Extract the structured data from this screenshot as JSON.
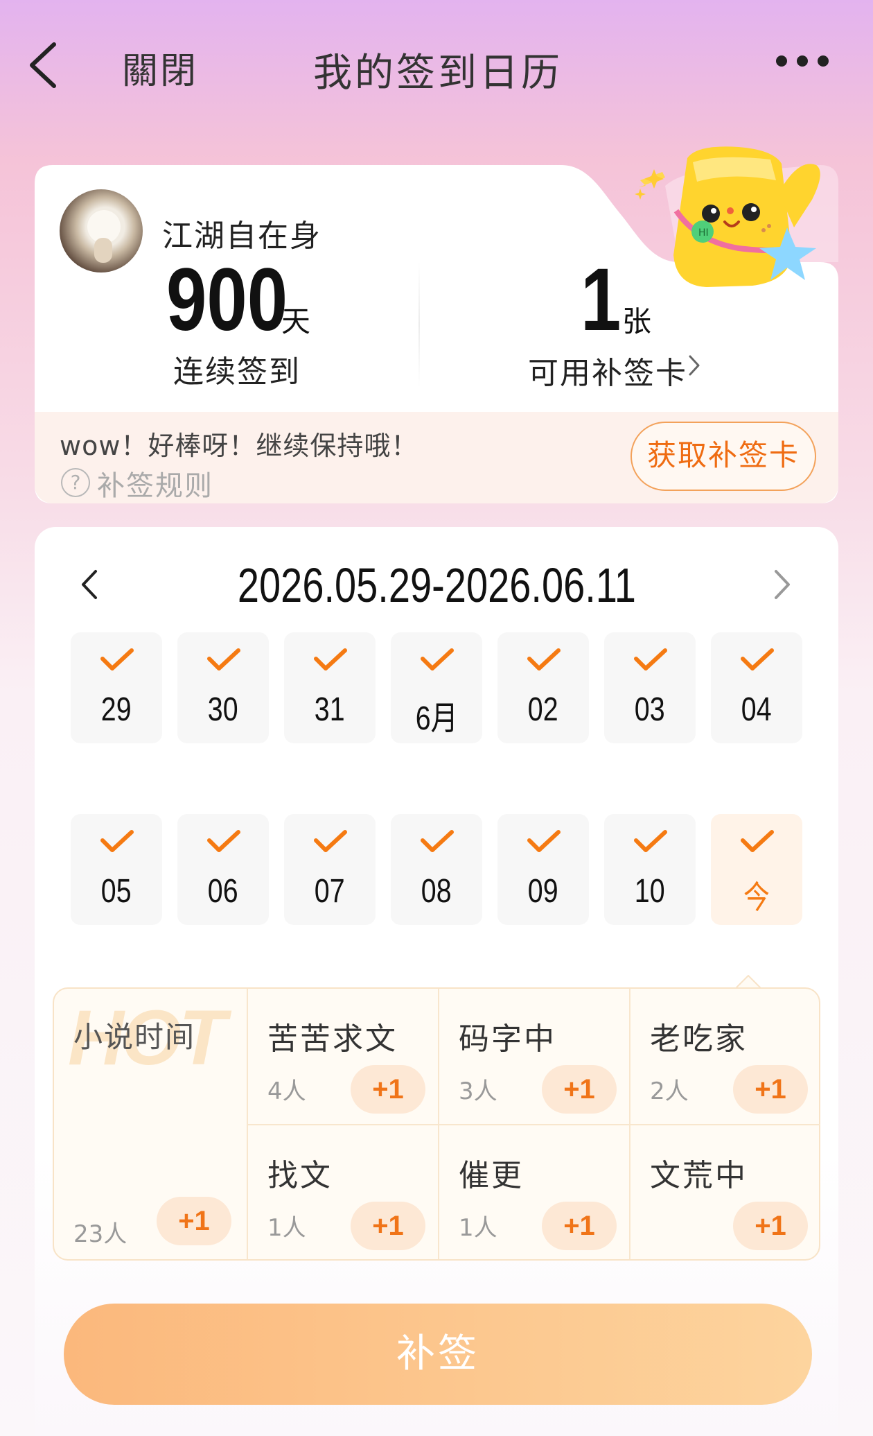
{
  "header": {
    "close_label": "關閉",
    "title": "我的签到日历"
  },
  "user": {
    "name": "江湖自在身",
    "streak_days": "900",
    "streak_unit": "天",
    "streak_label": "连续签到",
    "cards_count": "1",
    "cards_unit": "张",
    "cards_label": "可用补签卡",
    "encourage": "wow！好棒呀！继续保持哦！",
    "rule_label": "补签规则",
    "get_card_button": "获取补签卡"
  },
  "calendar": {
    "range": "2026.05.29-2026.06.11",
    "days": [
      {
        "label": "29",
        "checked": true
      },
      {
        "label": "30",
        "checked": true
      },
      {
        "label": "31",
        "checked": true
      },
      {
        "label": "6月",
        "checked": true
      },
      {
        "label": "02",
        "checked": true
      },
      {
        "label": "03",
        "checked": true
      },
      {
        "label": "04",
        "checked": true
      },
      {
        "label": "05",
        "checked": true
      },
      {
        "label": "06",
        "checked": true
      },
      {
        "label": "07",
        "checked": true
      },
      {
        "label": "08",
        "checked": true
      },
      {
        "label": "09",
        "checked": true
      },
      {
        "label": "10",
        "checked": true
      },
      {
        "label": "今",
        "checked": true,
        "today": true
      }
    ]
  },
  "topics": {
    "hot_watermark": "HOT",
    "main": {
      "title": "小说时间",
      "count": "23人",
      "plus": "+1"
    },
    "items": [
      {
        "title": "苦苦求文",
        "count": "4人",
        "plus": "+1"
      },
      {
        "title": "码字中",
        "count": "3人",
        "plus": "+1"
      },
      {
        "title": "老吃家",
        "count": "2人",
        "plus": "+1"
      },
      {
        "title": "找文",
        "count": "1人",
        "plus": "+1"
      },
      {
        "title": "催更",
        "count": "1人",
        "plus": "+1"
      },
      {
        "title": "文荒中",
        "count": "",
        "plus": "+1"
      }
    ]
  },
  "resign_button": "补签",
  "colors": {
    "accent": "#f57a12",
    "button_gradient_start": "#fbb87c",
    "button_gradient_end": "#fdd49e"
  }
}
